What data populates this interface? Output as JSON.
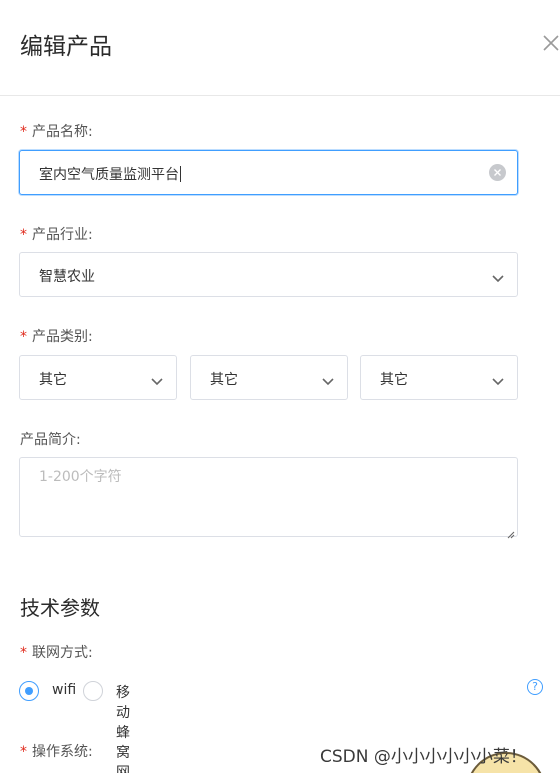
{
  "dialog": {
    "title": "编辑产品",
    "close_icon": "close-icon"
  },
  "form": {
    "name": {
      "label": "产品名称:",
      "value": "室内空气质量监测平台",
      "required": true
    },
    "industry": {
      "label": "产品行业:",
      "value": "智慧农业",
      "required": true
    },
    "category": {
      "label": "产品类别:",
      "required": true,
      "levels": [
        "其它",
        "其它",
        "其它"
      ]
    },
    "intro": {
      "label": "产品简介:",
      "placeholder": "1-200个字符"
    }
  },
  "tech": {
    "title": "技术参数",
    "network": {
      "label": "联网方式:",
      "required": true,
      "options": [
        "wifi",
        "移动蜂窝网络"
      ],
      "selected": "wifi"
    },
    "os": {
      "label": "操作系统:",
      "required": true
    }
  },
  "watermark": "CSDN @小小小小小小菜！",
  "colors": {
    "accent": "#409eff",
    "required": "#e0291b",
    "border": "#dcdfe6"
  }
}
